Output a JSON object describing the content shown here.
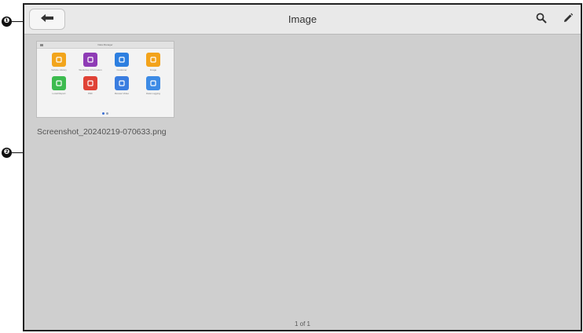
{
  "callouts": [
    "❶",
    "❷"
  ],
  "header": {
    "title": "Image",
    "back_icon": "arrow-left-icon",
    "actions": [
      {
        "name": "search",
        "icon": "search-icon"
      },
      {
        "name": "edit",
        "icon": "pencil-icon"
      }
    ]
  },
  "gallery": {
    "items": [
      {
        "filename": "Screenshot_20240219-070633.png",
        "thumbnail": {
          "title": "Data Manager",
          "apps": [
            {
              "label": "Vehicle History",
              "icon": "vehicle-history-icon",
              "color": "#f2a51c"
            },
            {
              "label": "Workshop Information",
              "icon": "workshop-icon",
              "color": "#8e3bb5"
            },
            {
              "label": "Customer",
              "icon": "customer-icon",
              "color": "#2d7fe0"
            },
            {
              "label": "Image",
              "icon": "image-icon",
              "color": "#f3a31a"
            },
            {
              "label": "Local Report",
              "icon": "report-icon",
              "color": "#3dbb4f"
            },
            {
              "label": "PDF",
              "icon": "pdf-icon",
              "color": "#e04236"
            },
            {
              "label": "Review Video",
              "icon": "video-icon",
              "color": "#3a7de0"
            },
            {
              "label": "Data Logging",
              "icon": "data-logging-icon",
              "color": "#3d8be5"
            }
          ]
        }
      }
    ]
  },
  "pagination": "1 of 1"
}
